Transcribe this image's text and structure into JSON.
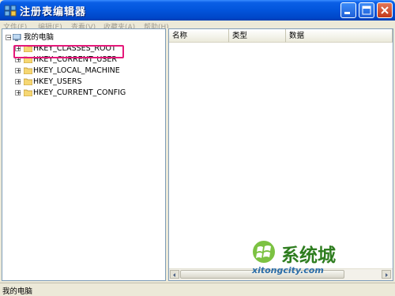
{
  "window": {
    "title": "注册表编辑器",
    "controls": {
      "minimize": "minimize",
      "maximize": "maximize",
      "close": "close"
    }
  },
  "menu": [
    {
      "label": "文件(F)"
    },
    {
      "label": "编辑(E)"
    },
    {
      "label": "查看(V)"
    },
    {
      "label": "收藏夹(A)"
    },
    {
      "label": "帮助(H)"
    }
  ],
  "tree": {
    "root": {
      "label": "我的电脑",
      "icon": "computer-icon",
      "expander": "−"
    },
    "items": [
      {
        "label": "HKEY_CLASSES_ROOT",
        "icon": "folder-icon",
        "expander": "+"
      },
      {
        "label": "HKEY_CURRENT_USER",
        "icon": "folder-icon",
        "expander": "+"
      },
      {
        "label": "HKEY_LOCAL_MACHINE",
        "icon": "folder-icon",
        "expander": "+"
      },
      {
        "label": "HKEY_USERS",
        "icon": "folder-icon",
        "expander": "+"
      },
      {
        "label": "HKEY_CURRENT_CONFIG",
        "icon": "folder-icon",
        "expander": "+"
      }
    ],
    "highlighted_item": "HKEY_CLASSES_ROOT",
    "highlight_color": "#E5197A"
  },
  "list": {
    "columns": [
      {
        "label": "名称"
      },
      {
        "label": "类型"
      },
      {
        "label": "数据"
      }
    ]
  },
  "status": {
    "text": "我的电脑"
  },
  "watermark": {
    "name": "系统城",
    "url": "xitongcity.com"
  },
  "colors": {
    "titlebar": "#0254DB",
    "frame": "#ECE9D8",
    "close_button": "#C2391C",
    "logo_green": "#2E7D1F"
  }
}
